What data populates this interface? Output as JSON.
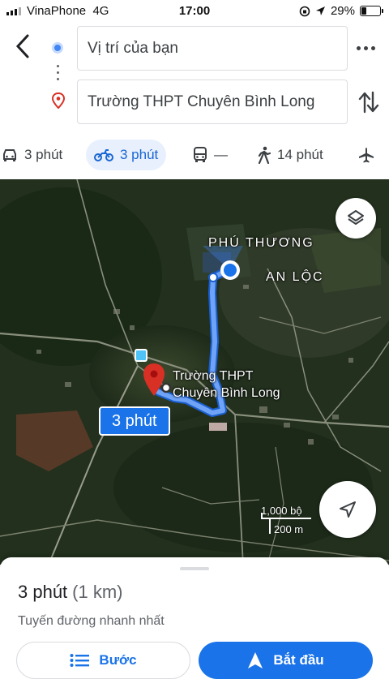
{
  "status_bar": {
    "carrier": "VinaPhone",
    "network": "4G",
    "time": "17:00",
    "battery": "29%",
    "battery_level": 0.29
  },
  "directions": {
    "origin": "Vị trí của bạn",
    "destination": "Trường THPT Chuyên Bình Long"
  },
  "modes": [
    {
      "name": "drive",
      "icon": "car-icon",
      "label": "3 phút",
      "active": false
    },
    {
      "name": "motorbike",
      "icon": "motorbike-icon",
      "label": "3 phút",
      "active": true
    },
    {
      "name": "transit",
      "icon": "bus-icon",
      "label": "—",
      "active": false
    },
    {
      "name": "walk",
      "icon": "walk-icon",
      "label": "14 phút",
      "active": false
    },
    {
      "name": "flight",
      "icon": "airplane-icon",
      "label": "",
      "active": false
    }
  ],
  "map": {
    "area_label_1": "PHÚ THƯƠNG",
    "area_label_2": "AN LỘC",
    "destination_label_line1": "Trường THPT",
    "destination_label_line2": "Chuyên Bình Long",
    "eta_badge": "3 phút",
    "scale_imperial": "1,000 bộ",
    "scale_metric": "200 m",
    "route_color": "#4285f4"
  },
  "sheet": {
    "duration": "3 phút",
    "distance": "(1 km)",
    "route_note": "Tuyến đường nhanh nhất",
    "steps_button": "Bước",
    "start_button": "Bắt đầu"
  }
}
